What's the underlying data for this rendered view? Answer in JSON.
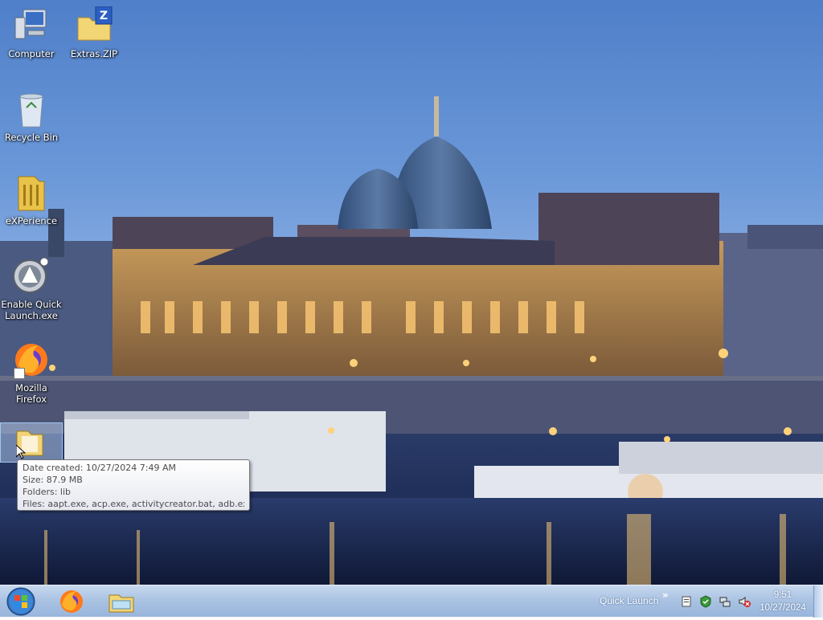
{
  "desktop": {
    "icons": [
      {
        "label": "Computer",
        "icon": "computer-icon"
      },
      {
        "label": "Extras.ZIP",
        "icon": "zip-folder-icon"
      },
      {
        "label": "Recycle Bin",
        "icon": "recycle-bin-icon"
      },
      {
        "label": "eXPerience",
        "icon": "folder-icon"
      },
      {
        "label": "Enable Quick Launch.exe",
        "icon": "quick-launch-icon"
      },
      {
        "label": "Mozilla Firefox",
        "icon": "firefox-icon"
      },
      {
        "label": "",
        "icon": "folder-icon"
      }
    ]
  },
  "tooltip": {
    "date_created": "Date created: 10/27/2024 7:49 AM",
    "size": "Size: 87.9 MB",
    "folders": "Folders: lib",
    "files": "Files: aapt.exe, acp.exe, activitycreator.bat, adb.exe, ..."
  },
  "taskbar": {
    "start_icon": "windows-orb-icon",
    "pinned": [
      "firefox-icon",
      "windows-explorer-icon"
    ],
    "quick_launch_label": "Quick Launch",
    "quick_launch_chevron": "»",
    "tray_icons": [
      "action-center-icon",
      "security-icon",
      "network-icon",
      "volume-muted-icon"
    ],
    "clock_time": "9:51",
    "clock_date": "10/27/2024"
  },
  "colors": {
    "taskbar": "#a9c2e2",
    "sky": "#6b98d8",
    "water": "#1d2c55",
    "lights": "#ffd27a"
  }
}
